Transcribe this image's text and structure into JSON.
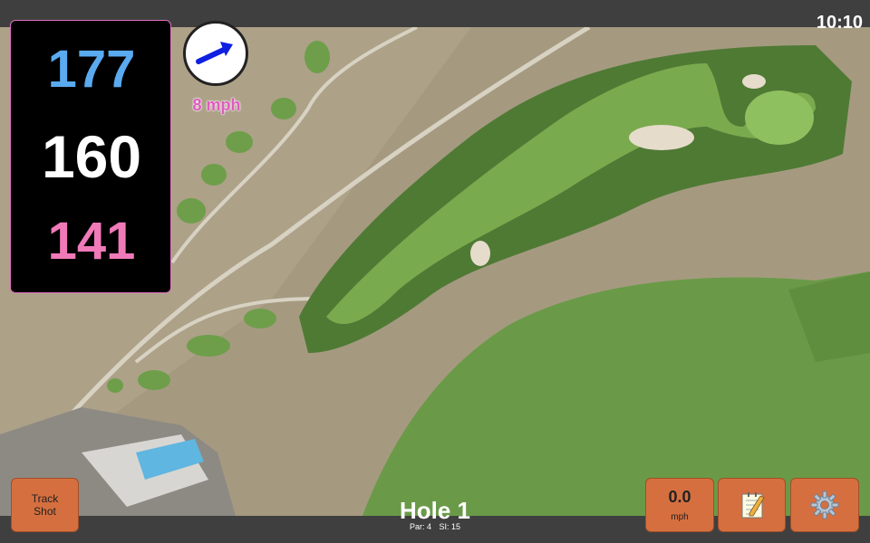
{
  "status_bar": {
    "time": "10:10"
  },
  "distances": {
    "back": "177",
    "middle": "160",
    "front": "141"
  },
  "wind": {
    "speed_label": "8 mph",
    "direction_icon": "arrow-icon",
    "arrow_color": "#1020e0"
  },
  "hole": {
    "title": "Hole 1",
    "par_label": "Par: 4",
    "si_label": "SI: 15"
  },
  "buttons": {
    "track_shot_label": "Track Shot",
    "speed_value": "0.0",
    "speed_unit": "mph",
    "notes_icon": "notepad-icon",
    "settings_icon": "gear-icon"
  },
  "colors": {
    "back_distance": "#5aaaf0",
    "middle_distance": "#ffffff",
    "front_distance": "#f07ab8",
    "button_bg": "#d66f3f",
    "wind_label": "#e05ac0"
  }
}
